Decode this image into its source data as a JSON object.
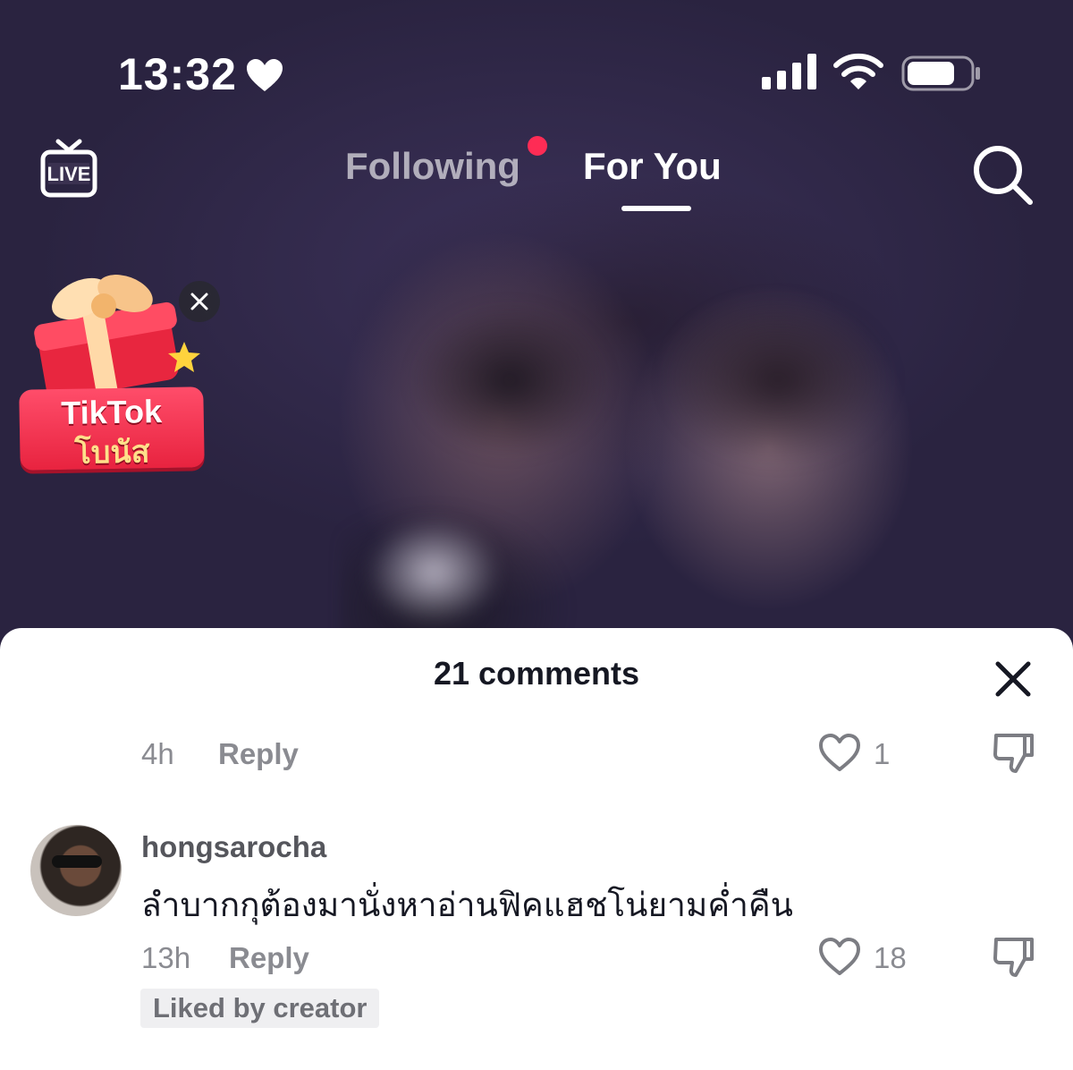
{
  "status_bar": {
    "time": "13:32",
    "icons": [
      "heart-icon",
      "signal-icon",
      "wifi-icon",
      "battery-icon"
    ]
  },
  "top_nav": {
    "live_label": "LIVE",
    "tabs": [
      {
        "label": "Following",
        "has_notification": true
      },
      {
        "label": "For You",
        "active": true
      }
    ]
  },
  "bonus_widget": {
    "line1": "TikTok",
    "line2": "โบนัส"
  },
  "comments_sheet": {
    "title": "21 comments",
    "comments": [
      {
        "time": "4h",
        "reply_label": "Reply",
        "likes": "1"
      },
      {
        "username": "hongsarocha",
        "text": "ลำบากกุต้องมานั่งหาอ่านฟิคแฮชโน่ยามค่ำคืน",
        "time": "13h",
        "reply_label": "Reply",
        "likes": "18",
        "badge": "Liked by creator"
      }
    ]
  },
  "colors": {
    "accent": "#fe2c55",
    "text_primary": "#161823",
    "text_secondary": "#8a8b91"
  }
}
